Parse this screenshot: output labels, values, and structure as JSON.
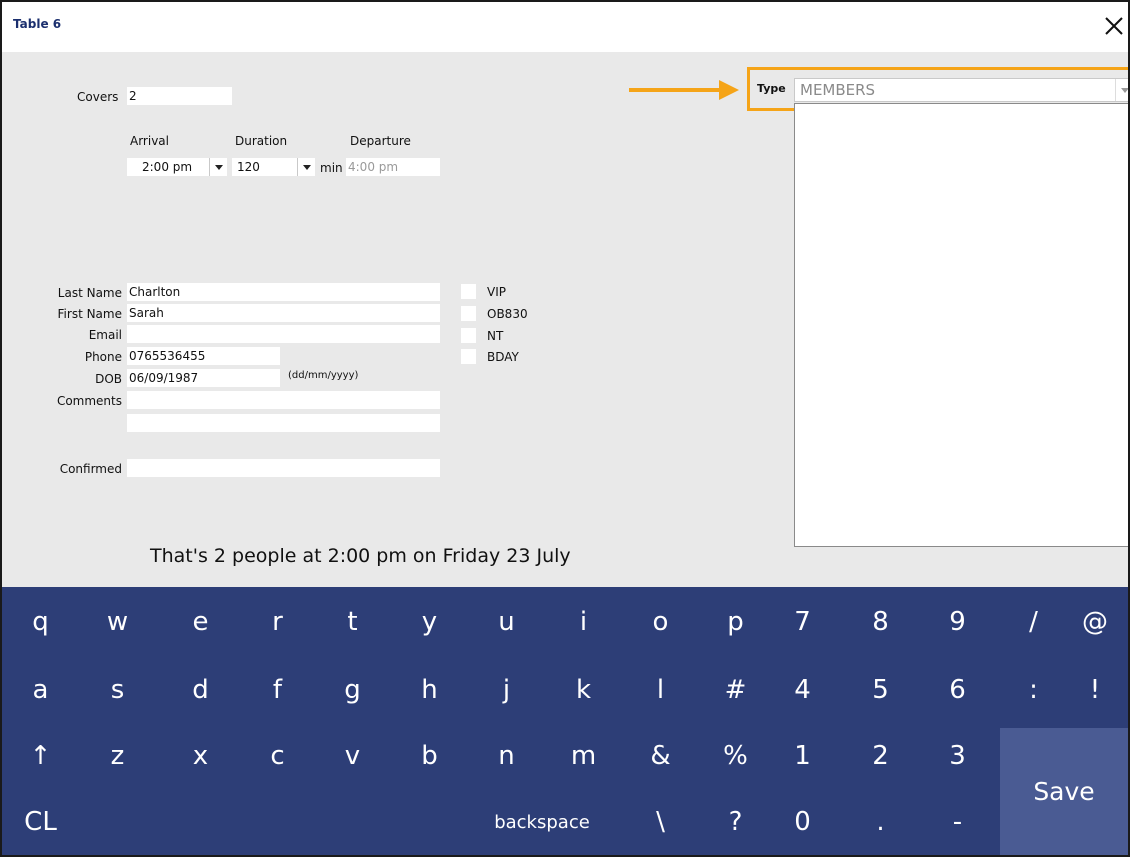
{
  "window": {
    "title": "Table 6",
    "close_icon": "close-icon"
  },
  "form": {
    "covers_label": "Covers",
    "covers_value": "2",
    "arrival_label": "Arrival",
    "arrival_value": "2:00 pm",
    "duration_label": "Duration",
    "duration_value": "120",
    "duration_unit": "min",
    "departure_label": "Departure",
    "departure_value": "4:00 pm",
    "last_name_label": "Last Name",
    "last_name_value": "Charlton",
    "first_name_label": "First Name",
    "first_name_value": "Sarah",
    "email_label": "Email",
    "email_value": "",
    "phone_label": "Phone",
    "phone_value": "0765536455",
    "dob_label": "DOB",
    "dob_value": "06/09/1987",
    "dob_format": "(dd/mm/yyyy)",
    "comments_label": "Comments",
    "comments_line1": "",
    "comments_line2": "",
    "confirmed_label": "Confirmed",
    "confirmed_value": ""
  },
  "flags": [
    {
      "label": "VIP",
      "checked": false
    },
    {
      "label": "OB830",
      "checked": false
    },
    {
      "label": "NT",
      "checked": false
    },
    {
      "label": "BDAY",
      "checked": false
    }
  ],
  "type": {
    "label": "Type",
    "value": "MEMBERS",
    "highlight_color": "#f5a418"
  },
  "summary": "That's 2 people at 2:00 pm on Friday 23 July",
  "keyboard": {
    "row1": [
      "q",
      "w",
      "e",
      "r",
      "t",
      "y",
      "u",
      "i",
      "o",
      "p",
      "7",
      "8",
      "9",
      "/",
      "@"
    ],
    "row2": [
      "a",
      "s",
      "d",
      "f",
      "g",
      "h",
      "j",
      "k",
      "l",
      "#",
      "4",
      "5",
      "6",
      ":",
      "!"
    ],
    "row3": [
      "↑",
      "z",
      "x",
      "c",
      "v",
      "b",
      "n",
      "m",
      "&",
      "%",
      "1",
      "2",
      "3"
    ],
    "row4_cl": "CL",
    "row4_backspace": "backspace",
    "row4_rest": [
      "\\",
      "?",
      "0",
      ".",
      "-"
    ],
    "save": "Save",
    "background": "#2d3e77"
  }
}
